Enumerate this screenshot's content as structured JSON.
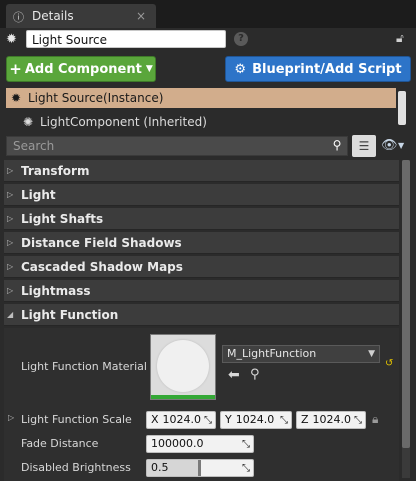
{
  "tab": {
    "title": "Details",
    "icon": "details-icon",
    "close": "×"
  },
  "name_row": {
    "value": "Light Source",
    "help": "?",
    "actor_icon": "light-actor-icon"
  },
  "buttons": {
    "add_component": "Add Component",
    "blueprint": "Blueprint/Add Script"
  },
  "tree": {
    "selected": "Light Source(Instance)",
    "child": "LightComponent (Inherited)"
  },
  "search": {
    "placeholder": "Search"
  },
  "categories": [
    "Transform",
    "Light",
    "Light Shafts",
    "Distance Field Shadows",
    "Cascaded Shadow Maps",
    "Lightmass",
    "Light Function"
  ],
  "light_function": {
    "material_label": "Light Function Material",
    "material_value": "M_LightFunction",
    "scale_label": "Light Function Scale",
    "scale": {
      "x": "1024.0",
      "y": "1024.0",
      "z": "1024.0"
    },
    "fade_label": "Fade Distance",
    "fade_value": "100000.0",
    "disabled_label": "Disabled Brightness",
    "disabled_value": "0.5",
    "disabled_fraction": 0.5
  },
  "colors": {
    "add_green": "#5aa63b",
    "blueprint_blue": "#2d74c8",
    "selection": "#d2ad8c"
  }
}
